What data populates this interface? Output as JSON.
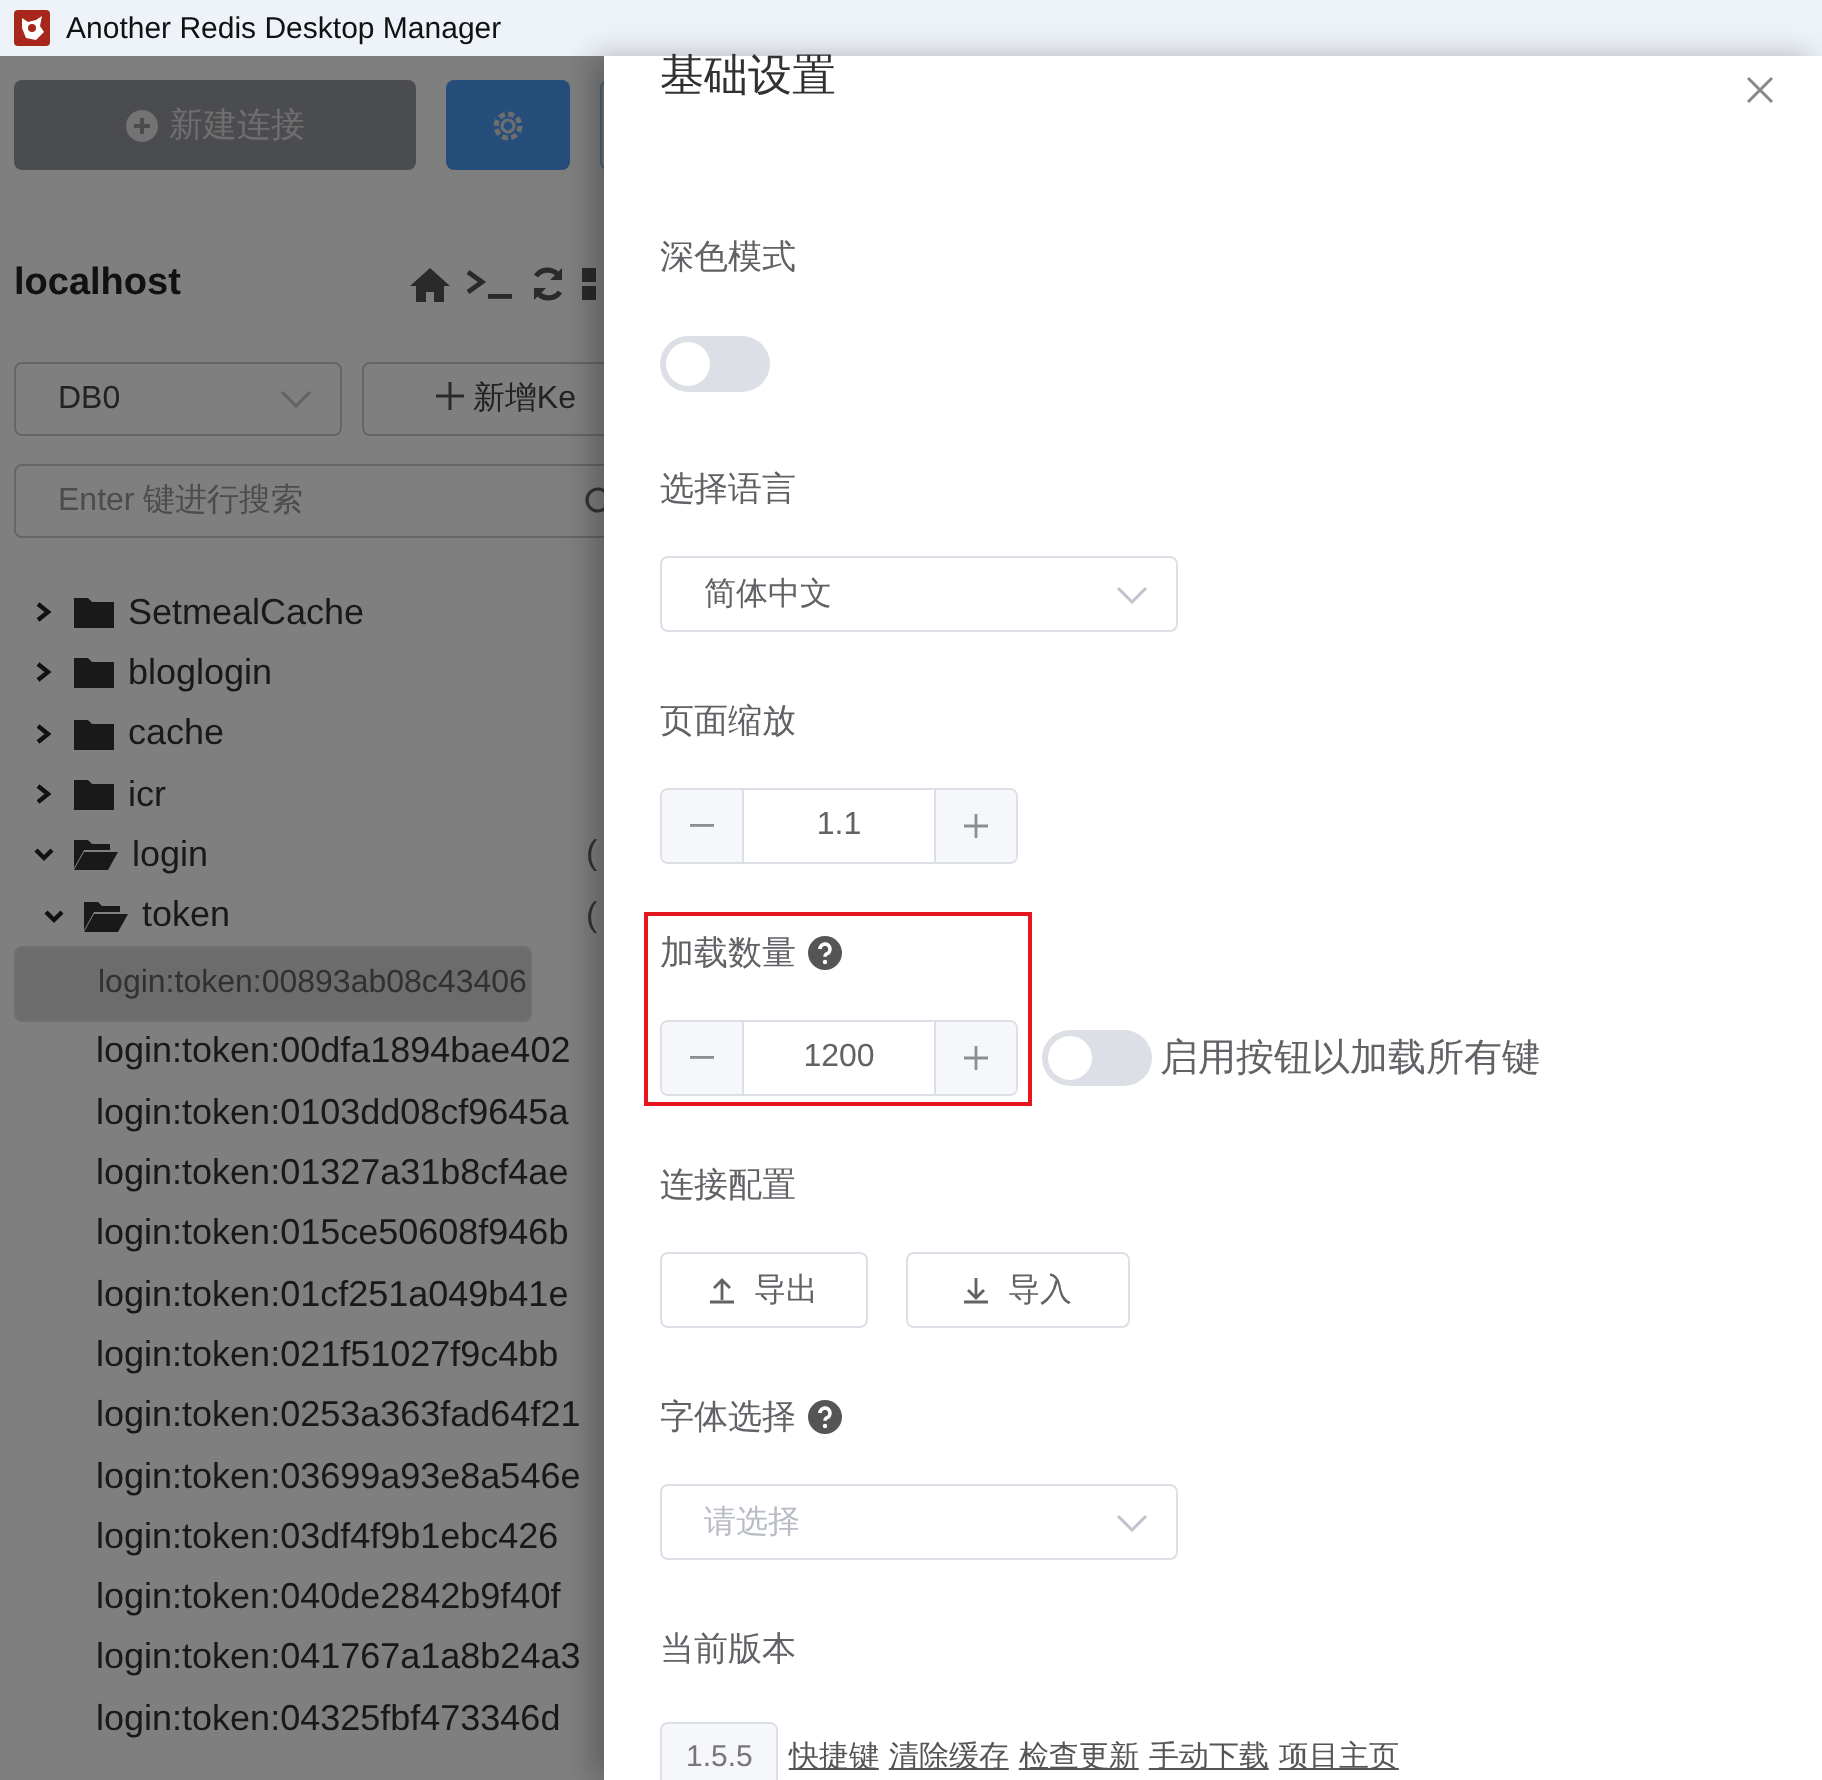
{
  "window": {
    "title": "Another Redis Desktop Manager"
  },
  "sidebar": {
    "new_connection_button": "新建连接",
    "connection": "localhost",
    "db_select": "DB0",
    "add_key_button": "新增Ke",
    "search": {
      "placeholder": "Enter 键进行搜索"
    },
    "tree": [
      {
        "kind": "folder",
        "label": "SetmealCache",
        "expanded": false
      },
      {
        "kind": "folder",
        "label": "bloglogin",
        "expanded": false
      },
      {
        "kind": "folder",
        "label": "cache",
        "expanded": false
      },
      {
        "kind": "folder",
        "label": "icr",
        "expanded": false
      },
      {
        "kind": "folder",
        "label": "login",
        "expanded": true,
        "count": "(",
        "children": [
          {
            "kind": "folder",
            "label": "token",
            "expanded": true,
            "count": "(",
            "children": [
              {
                "kind": "key",
                "label": "login:token:00893ab08c43406",
                "selected": true
              },
              {
                "kind": "key",
                "label": "login:token:00dfa1894bae402",
                "selected": false
              },
              {
                "kind": "key",
                "label": "login:token:0103dd08cf9645a",
                "selected": false
              },
              {
                "kind": "key",
                "label": "login:token:01327a31b8cf4ae",
                "selected": false
              },
              {
                "kind": "key",
                "label": "login:token:015ce50608f946b",
                "selected": false
              },
              {
                "kind": "key",
                "label": "login:token:01cf251a049b41e",
                "selected": false
              },
              {
                "kind": "key",
                "label": "login:token:021f51027f9c4bb",
                "selected": false
              },
              {
                "kind": "key",
                "label": "login:token:0253a363fad64f21",
                "selected": false
              },
              {
                "kind": "key",
                "label": "login:token:03699a93e8a546e",
                "selected": false
              },
              {
                "kind": "key",
                "label": "login:token:03df4f9b1ebc426",
                "selected": false
              },
              {
                "kind": "key",
                "label": "login:token:040de2842b9f40f",
                "selected": false
              },
              {
                "kind": "key",
                "label": "login:token:041767a1a8b24a3",
                "selected": false
              },
              {
                "kind": "key",
                "label": "login:token:04325fbf473346d",
                "selected": false
              }
            ]
          }
        ]
      }
    ]
  },
  "drawer": {
    "title": "基础设置",
    "settings": [
      {
        "kind": "toggle",
        "label": "深色模式",
        "on": false
      },
      {
        "kind": "select",
        "label": "选择语言",
        "value": "简体中文"
      },
      {
        "kind": "number",
        "label": "页面缩放",
        "value": "1.1",
        "help": false,
        "highlighted": false
      },
      {
        "kind": "number",
        "label": "加载数量",
        "value": "1200",
        "help": true,
        "highlighted": true,
        "switch": {
          "label": "启用按钮以加载所有键",
          "on": false
        }
      },
      {
        "kind": "buttons",
        "label": "连接配置",
        "buttons": [
          {
            "label": "导出"
          },
          {
            "label": "导入"
          }
        ]
      },
      {
        "kind": "select",
        "label": "字体选择",
        "help": true,
        "placeholder": "请选择"
      },
      {
        "kind": "version",
        "label": "当前版本",
        "version": "1.5.5",
        "links": [
          "快捷键",
          "清除缓存",
          "检查更新",
          "手动下载",
          "项目主页"
        ]
      }
    ]
  }
}
